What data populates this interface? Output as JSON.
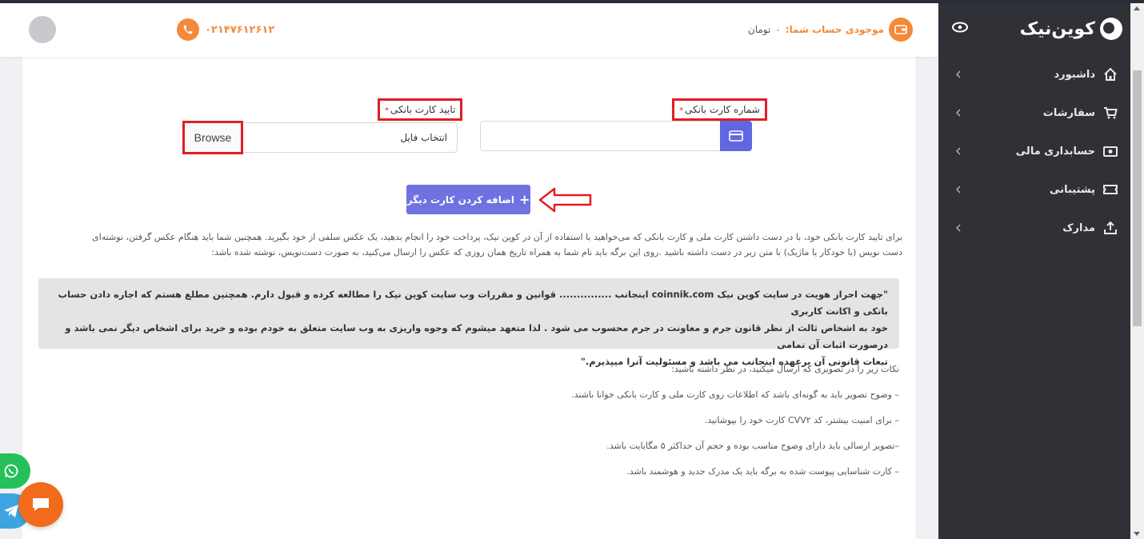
{
  "header": {
    "balance_label": "موجودی حساب شما:",
    "balance_value": "۰",
    "balance_unit": "تومان",
    "phone": "۰۲۱۴۷۶۱۲۶۱۲"
  },
  "sidebar": {
    "logo": "کوین‌نیک",
    "items": [
      {
        "label": "داشبورد",
        "icon": "home-icon"
      },
      {
        "label": "سفارشات",
        "icon": "cart-icon"
      },
      {
        "label": "حسابداری مالی",
        "icon": "money-icon"
      },
      {
        "label": "پشتیبانی",
        "icon": "ticket-icon"
      },
      {
        "label": "مدارک",
        "icon": "upload-icon"
      }
    ]
  },
  "form": {
    "card_number_label": "شماره کارت بانکی",
    "card_verify_label": "تایید کارت بانکی",
    "required_mark": "*",
    "file_placeholder": "انتخاب فایل",
    "browse_label": "Browse",
    "add_button_label": "اضافه کردن کارت دیگر"
  },
  "instructions": {
    "line1": "برای تایید کارت بانکی خود، با در دست داشتن کارت ملی و کارت بانکی که می‌خواهید با استفاده از آن در کوین نیک، پرداخت خود را انجام بدهید، یک عکس سلفی از خود بگیرید. همچنین شما باید هنگام عکس گرفتن، نوشته‌ای",
    "line2": "دست نویس (با خودکار یا ماژیک) با متن زیر در دست داشته باشید .روی این برگه باید نام شما به همراه تاریخ همان روزی که عکس را ارسال می‌کنید، به صورت دست‌نویس، نوشته شده باشد:",
    "quote_line1": "\"جهت احراز هویت در سایت کوین نیک coinnik.com اینجانب ............... قوانین و مقررات وب سایت کوین نیک را مطالعه کرده و قبول دارم. همچنین مطلع هستم که اجاره دادن حساب بانکی و اکانت کاربری",
    "quote_line2": "خود به اشخاص ثالث از نظر قانون جرم و معاونت در جرم محسوب می شود . لذا متعهد میشوم که وجوه واریزی به وب سایت متعلق به خودم بوده و خرید برای اشخاص دیگر نمی باشد و درصورت اثبات آن تمامی",
    "quote_line3": "تبعات قانونی آن برعهده اینجانب می باشد و مسئولیت آنرا میپذیرم.\"",
    "notes_title": "نکات زیر را در تصویری که ارسال میکنید، در نظر داشته باشید:",
    "notes": [
      "– وضوح تصویر باید به گونه‌ای باشد که اطلاعات روی کارت ملی و کارت بانکی خوانا باشند.",
      "– برای امنیت بیشتر، کد CVV۲ کارت خود را بپوشانید.",
      "–تصویر ارسالی باید دارای وضوح مناسب بوده و حجم آن حداکثر ۵ مگابایت باشد.",
      "– کارت شناسایی پیوست شده به برگه باید یک مدرک جدید و هوشمند باشد."
    ]
  },
  "colors": {
    "accent": "#6f72e0",
    "orange": "#f4893a",
    "highlight_red": "#e01e25",
    "sidebar_bg": "#2f3136"
  }
}
